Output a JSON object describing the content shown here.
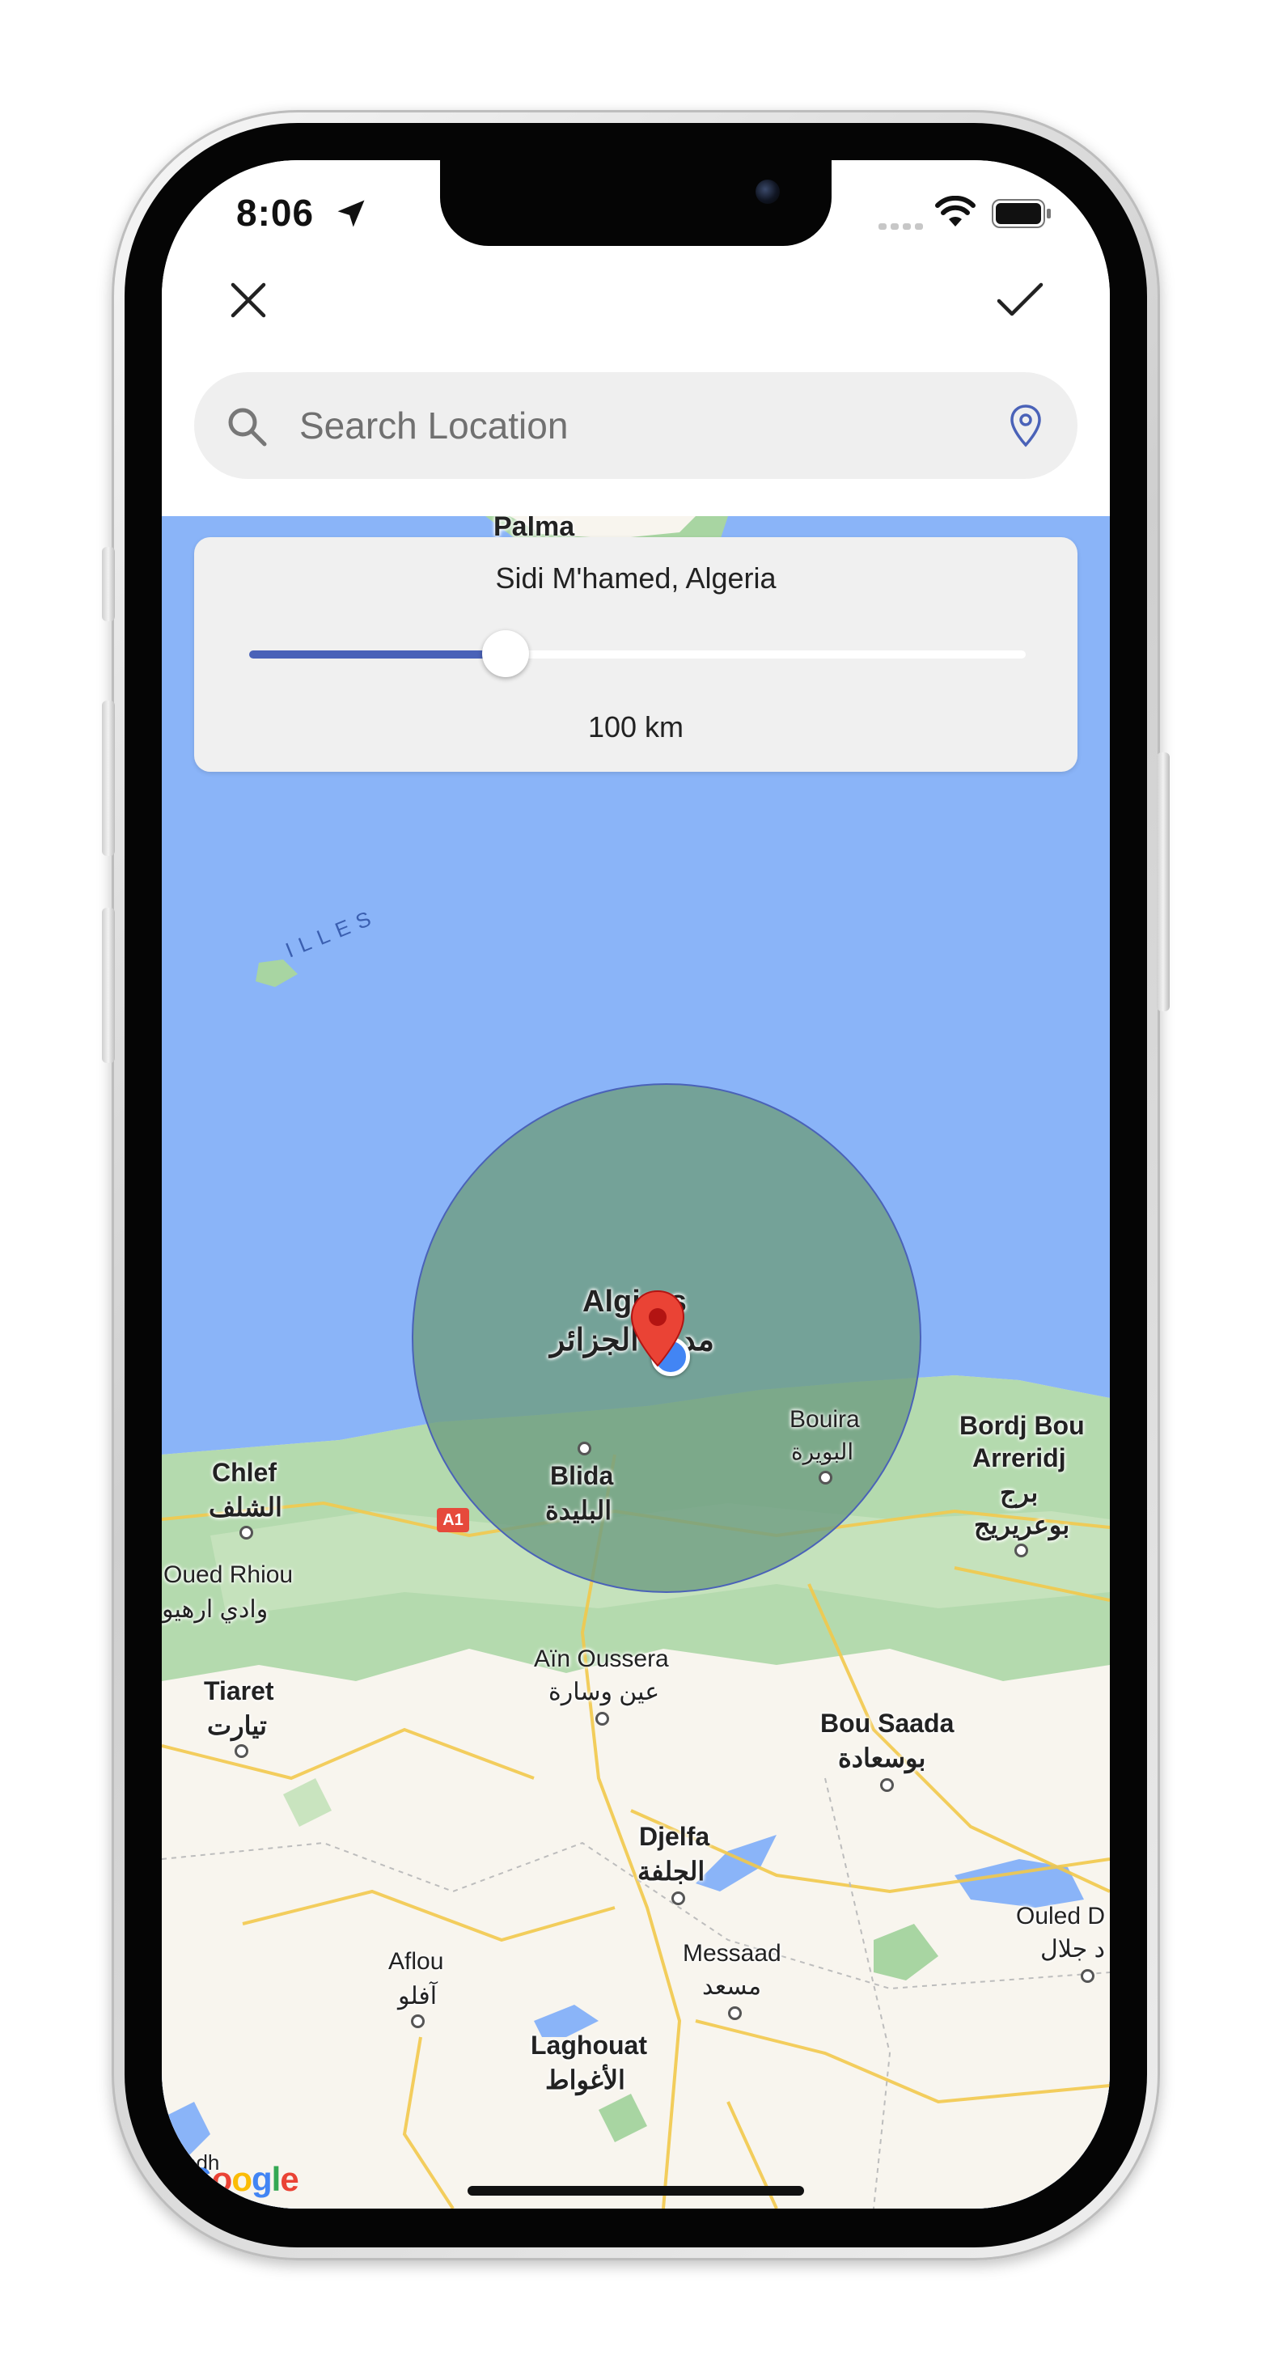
{
  "status_bar": {
    "time": "8:06"
  },
  "toolbar": {
    "close_icon": "close-icon",
    "confirm_icon": "checkmark-icon"
  },
  "search": {
    "placeholder": "Search Location",
    "value": ""
  },
  "radius_card": {
    "location": "Sidi M'hamed, Algeria",
    "radius_label": "100 km",
    "slider_fraction": 0.33
  },
  "map": {
    "labels": {
      "palma": "Palma",
      "illes": "ILLES",
      "algiers": "Algiers",
      "algiers_ar": "مدينة الجزائر",
      "bouira": "Bouira",
      "bouira_ar": "البويرة",
      "bordj_1": "Bordj Bou",
      "bordj_2": "Arreridj",
      "bordj_ar1": "برج",
      "bordj_ar2": "بوعريريج",
      "chlef": "Chlef",
      "chlef_ar": "الشلف",
      "blida": "Blida",
      "blida_ar": "البليدة",
      "oued_rhiou": "Oued Rhiou",
      "oued_rhiou_ar": "وادي ارهيو",
      "ain_oussera": "Aïn Oussera",
      "ain_oussera_ar": "عين وسارة",
      "tiaret": "Tiaret",
      "tiaret_ar": "تيارت",
      "bou_saada": "Bou Saada",
      "bou_saada_ar": "بوسعادة",
      "djelfa": "Djelfa",
      "djelfa_ar": "الجلفة",
      "ouled_djellal": "Ouled D",
      "ouled_djellal_ar": "د جلال",
      "aflou": "Aflou",
      "aflou_ar": "آفلو",
      "messaad": "Messaad",
      "messaad_ar": "مسعد",
      "laghouat": "Laghouat",
      "laghouat_ar": "الأغواط",
      "edh": "edh",
      "road_a1": "A1",
      "google": "Google"
    },
    "colors": {
      "sea": "#8ab4f8",
      "land": "#f8f5ee",
      "forest": "#a8d5a2",
      "radius_fill": "#6f9e83",
      "radius_stroke": "#4a62b8",
      "pin": "#ea4335"
    },
    "icons": [
      "location-pin-icon",
      "current-location-dot-icon",
      "google-logo"
    ]
  },
  "icons": {
    "search": "search-icon",
    "locate": "location-marker-icon",
    "signal": "cellular-signal-icon",
    "wifi": "wifi-icon",
    "battery": "battery-icon",
    "navigation": "location-arrow-icon"
  }
}
